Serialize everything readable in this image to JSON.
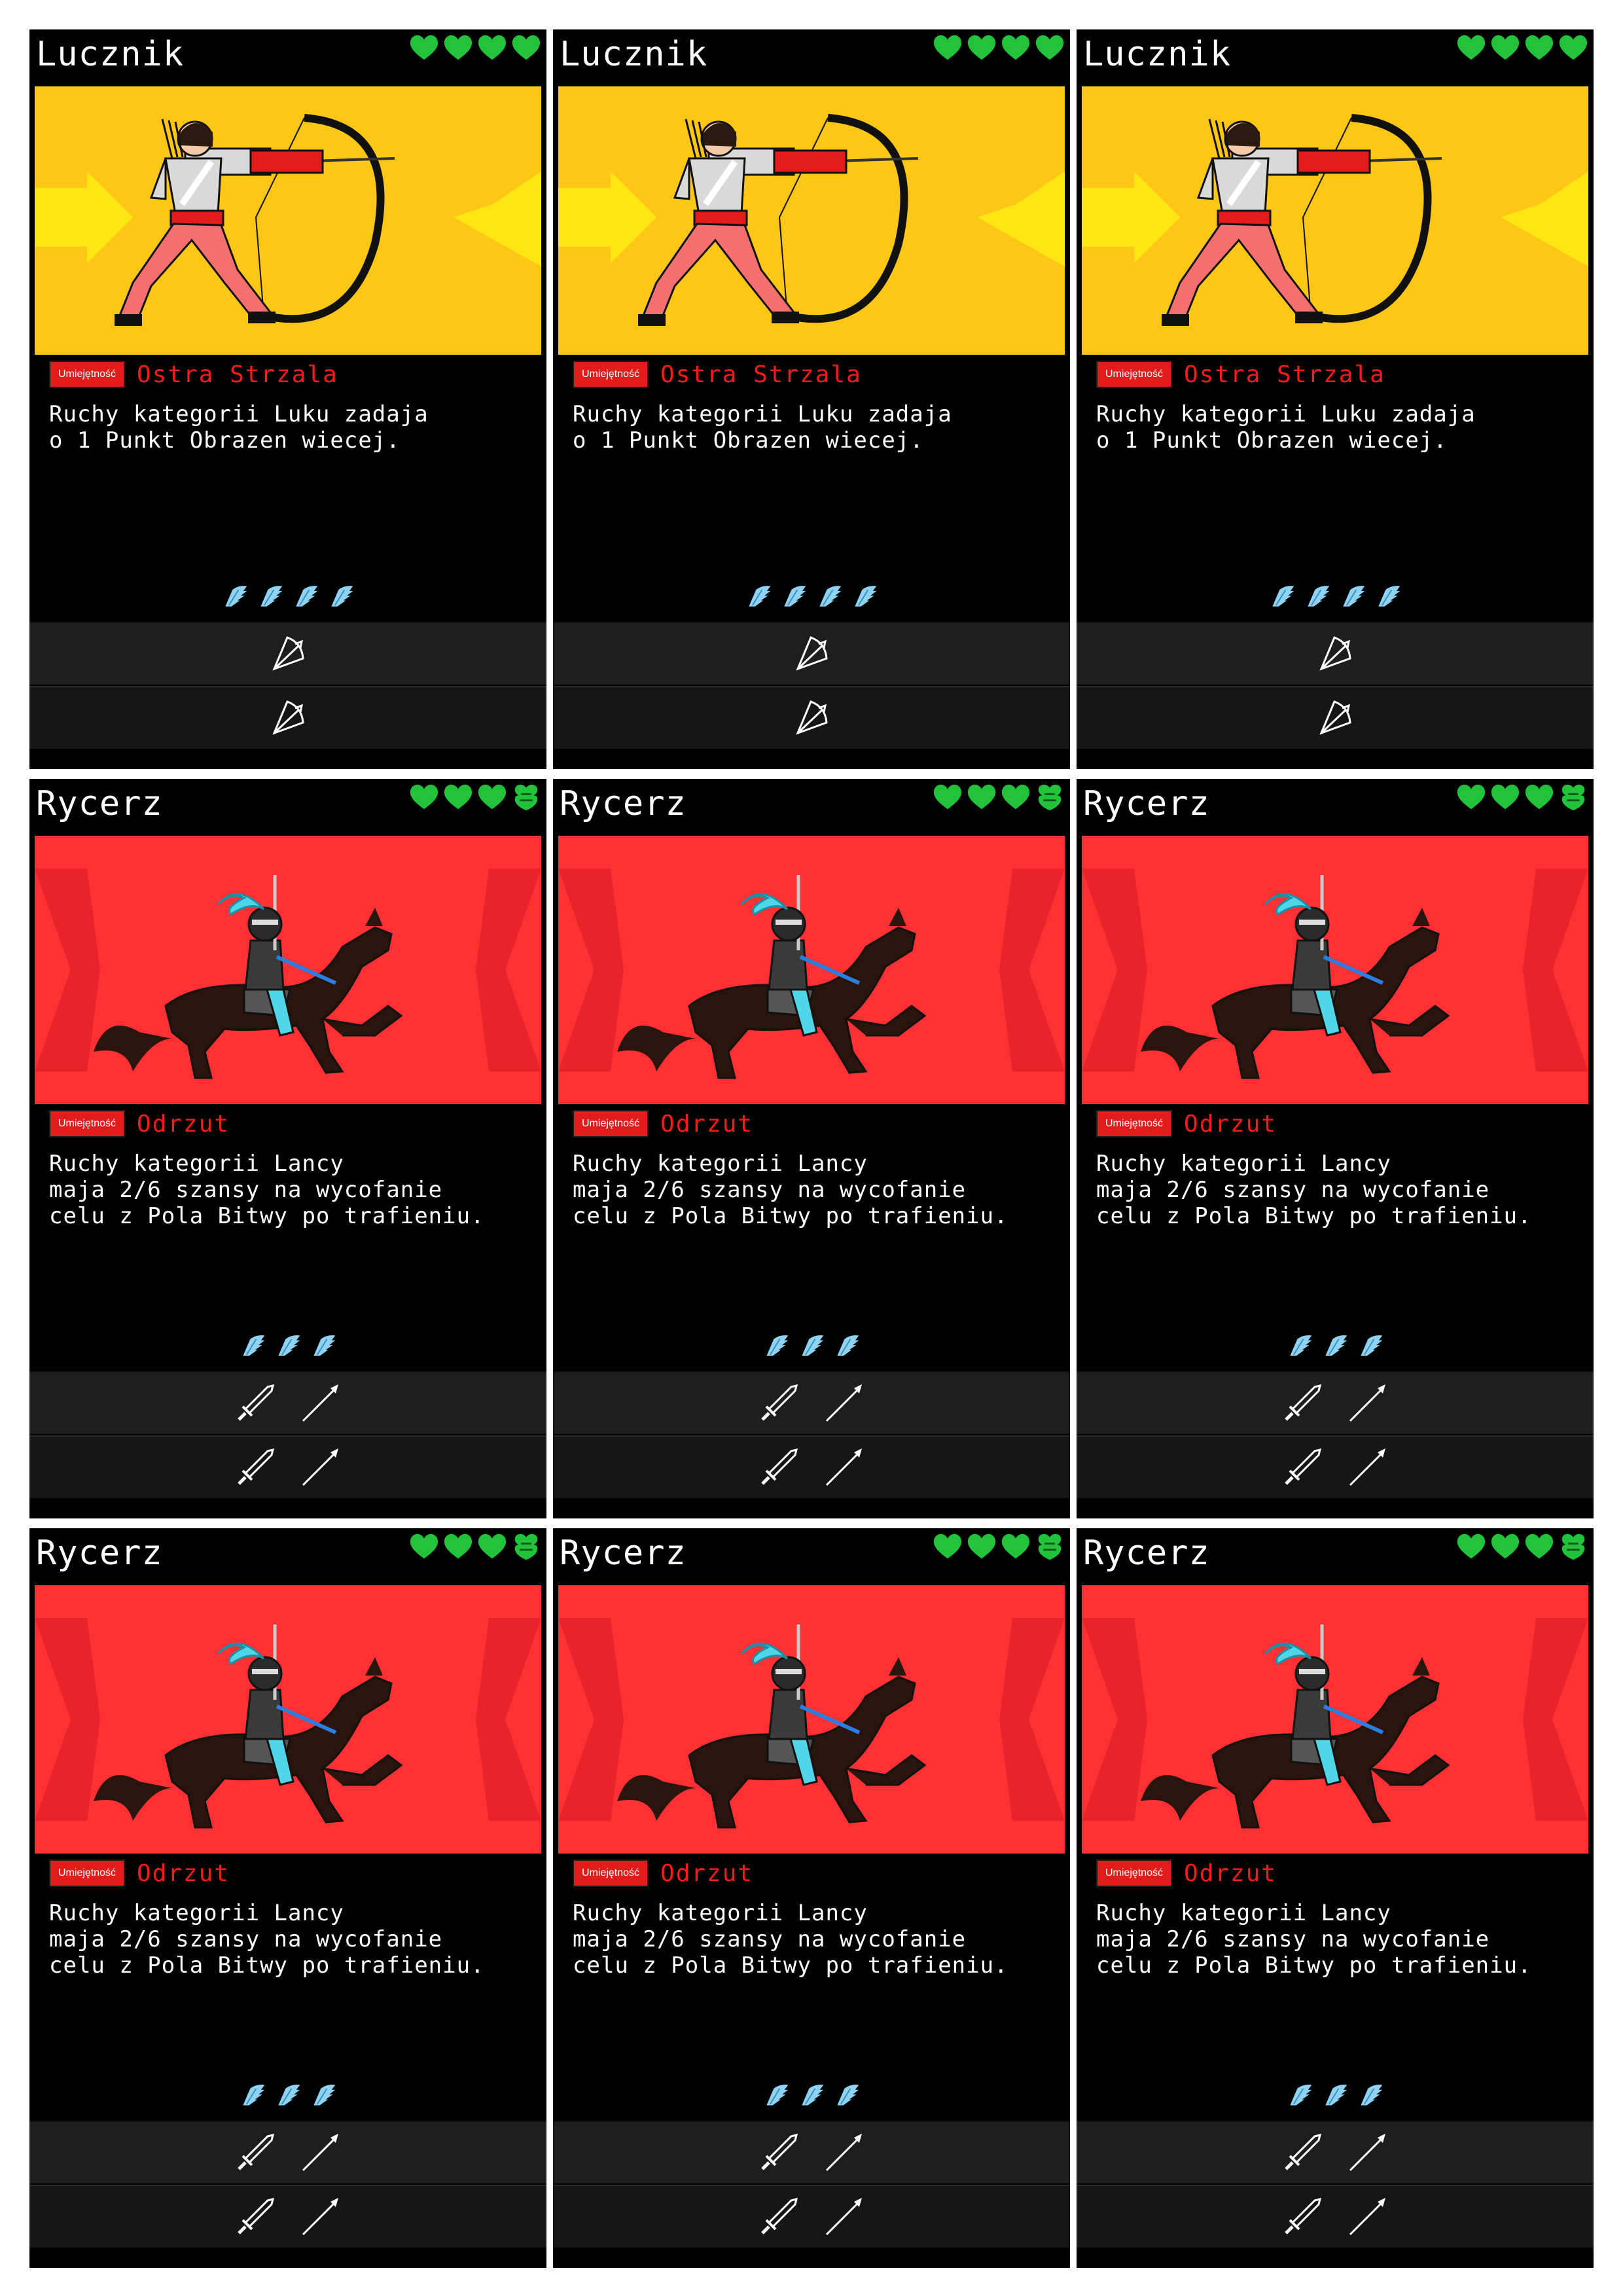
{
  "labels": {
    "ability_badge": "Umiejętność"
  },
  "colors": {
    "heart": "#22c23a",
    "heart_empty": "#1a8a2a",
    "wing": "#8fd3f4",
    "badge": "#e21b1b",
    "ability": "#ff1a1a"
  },
  "cards": [
    {
      "name": "Lucznik",
      "theme": "archer",
      "hearts": [
        true,
        true,
        true,
        true
      ],
      "ability_name": "Ostra Strzala",
      "desc": [
        "Ruchy kategorii Luku zadaja",
        "o 1 Punkt Obrazen wiecej."
      ],
      "speed": 4,
      "moves": [
        [
          "bow-icon"
        ],
        [
          "bow-icon"
        ]
      ]
    },
    {
      "name": "Lucznik",
      "theme": "archer",
      "hearts": [
        true,
        true,
        true,
        true
      ],
      "ability_name": "Ostra Strzala",
      "desc": [
        "Ruchy kategorii Luku zadaja",
        "o 1 Punkt Obrazen wiecej."
      ],
      "speed": 4,
      "moves": [
        [
          "bow-icon"
        ],
        [
          "bow-icon"
        ]
      ]
    },
    {
      "name": "Lucznik",
      "theme": "archer",
      "hearts": [
        true,
        true,
        true,
        true
      ],
      "ability_name": "Ostra Strzala",
      "desc": [
        "Ruchy kategorii Luku zadaja",
        "o 1 Punkt Obrazen wiecej."
      ],
      "speed": 4,
      "moves": [
        [
          "bow-icon"
        ],
        [
          "bow-icon"
        ]
      ]
    },
    {
      "name": "Rycerz",
      "theme": "knight",
      "hearts": [
        true,
        true,
        true,
        false
      ],
      "ability_name": "Odrzut",
      "desc": [
        "Ruchy kategorii Lancy",
        "maja 2/6 szansy na wycofanie",
        "celu z Pola Bitwy po trafieniu."
      ],
      "speed": 3,
      "moves": [
        [
          "sword-icon",
          "lance-icon"
        ],
        [
          "sword-icon",
          "lance-icon"
        ]
      ]
    },
    {
      "name": "Rycerz",
      "theme": "knight",
      "hearts": [
        true,
        true,
        true,
        false
      ],
      "ability_name": "Odrzut",
      "desc": [
        "Ruchy kategorii Lancy",
        "maja 2/6 szansy na wycofanie",
        "celu z Pola Bitwy po trafieniu."
      ],
      "speed": 3,
      "moves": [
        [
          "sword-icon",
          "lance-icon"
        ],
        [
          "sword-icon",
          "lance-icon"
        ]
      ]
    },
    {
      "name": "Rycerz",
      "theme": "knight",
      "hearts": [
        true,
        true,
        true,
        false
      ],
      "ability_name": "Odrzut",
      "desc": [
        "Ruchy kategorii Lancy",
        "maja 2/6 szansy na wycofanie",
        "celu z Pola Bitwy po trafieniu."
      ],
      "speed": 3,
      "moves": [
        [
          "sword-icon",
          "lance-icon"
        ],
        [
          "sword-icon",
          "lance-icon"
        ]
      ]
    },
    {
      "name": "Rycerz",
      "theme": "knight",
      "hearts": [
        true,
        true,
        true,
        false
      ],
      "ability_name": "Odrzut",
      "desc": [
        "Ruchy kategorii Lancy",
        "maja 2/6 szansy na wycofanie",
        "celu z Pola Bitwy po trafieniu."
      ],
      "speed": 3,
      "moves": [
        [
          "sword-icon",
          "lance-icon"
        ],
        [
          "sword-icon",
          "lance-icon"
        ]
      ]
    },
    {
      "name": "Rycerz",
      "theme": "knight",
      "hearts": [
        true,
        true,
        true,
        false
      ],
      "ability_name": "Odrzut",
      "desc": [
        "Ruchy kategorii Lancy",
        "maja 2/6 szansy na wycofanie",
        "celu z Pola Bitwy po trafieniu."
      ],
      "speed": 3,
      "moves": [
        [
          "sword-icon",
          "lance-icon"
        ],
        [
          "sword-icon",
          "lance-icon"
        ]
      ]
    },
    {
      "name": "Rycerz",
      "theme": "knight",
      "hearts": [
        true,
        true,
        true,
        false
      ],
      "ability_name": "Odrzut",
      "desc": [
        "Ruchy kategorii Lancy",
        "maja 2/6 szansy na wycofanie",
        "celu z Pola Bitwy po trafieniu."
      ],
      "speed": 3,
      "moves": [
        [
          "sword-icon",
          "lance-icon"
        ],
        [
          "sword-icon",
          "lance-icon"
        ]
      ]
    }
  ]
}
